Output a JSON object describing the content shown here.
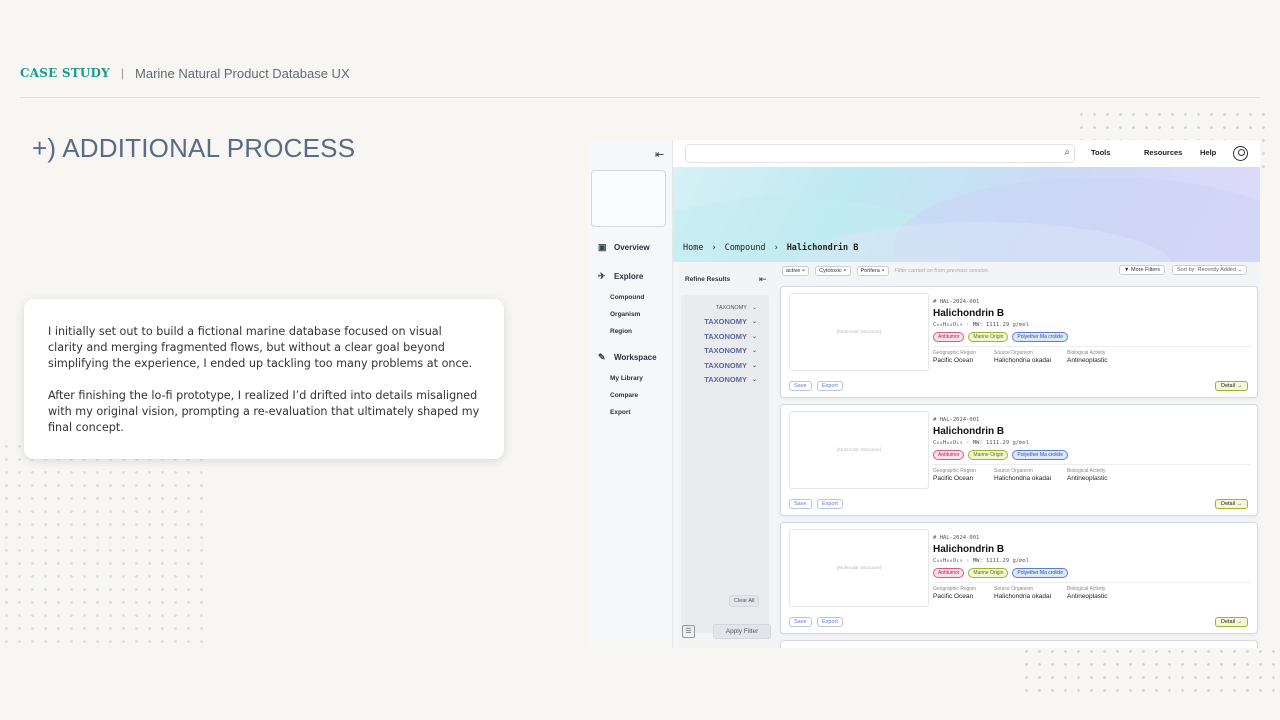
{
  "header": {
    "case_study": "CASE STUDY",
    "separator": "|",
    "subtitle": "Marine Natural Product Database UX"
  },
  "section_title": "+) ADDITIONAL PROCESS",
  "card": {
    "p1": "I initially set out to build a fictional marine database focused on visual clarity and merging fragmented flows, but without a clear goal beyond simplifying the experience, I ended up tackling too many problems at once.",
    "p2": "After finishing the lo-fi prototype, I realized I’d drifted into details misaligned with my original vision, prompting a re-evaluation that ultimately shaped my final concept."
  },
  "mock": {
    "collapse_icon": "collapse-left-icon",
    "nav": {
      "overview": "Overview",
      "explore": "Explore",
      "compound": "Compound",
      "organism": "Organism",
      "region": "Region",
      "workspace": "Workspace",
      "my_library": "My Library",
      "compare": "Compare",
      "export": "Export"
    },
    "topbar": {
      "tools": "Tools",
      "resources": "Resources",
      "help": "Help"
    },
    "breadcrumb": {
      "home": "Home",
      "sep": "›",
      "compound": "Compound",
      "current": "Halichondrin B"
    },
    "filters": {
      "title": "Refine Results",
      "taxonomy_small": "TAXONOMY",
      "taxonomy": "TAXONOMY",
      "clear_all": "Clear All",
      "apply": "Apply Filter"
    },
    "chips": [
      "active",
      "Cytotoxic",
      "Porifera"
    ],
    "chip_close": "×",
    "chips_hint": "Filter carried on from previous session.",
    "more_filters": "More Filters",
    "sort": "Sort by: Recently Added",
    "result": {
      "mol": "[Molecular Structure]",
      "id": "# HAL-2024-001",
      "name": "Halichondrin B",
      "formula": "C₆₀H₈₆O₁₉ · MW: 1111.29 g/mol",
      "tags": [
        "Antitumor",
        "Marine Origin",
        "Polyether Ma crolide"
      ],
      "geo_label": "Geographic Region",
      "geo": "Pacific Ocean",
      "org_label": "Source Organism",
      "org": "Halichondria okadai",
      "bio_label": "Biological Activity",
      "bio": "Antineoplastic",
      "save": "Save",
      "export": "Export",
      "detail": "Detail →"
    },
    "colors": {
      "accent": "#1a9a8c",
      "tag_pink": "#d45b85",
      "tag_green": "#9ab534",
      "tag_blue": "#5a7fcf"
    }
  }
}
